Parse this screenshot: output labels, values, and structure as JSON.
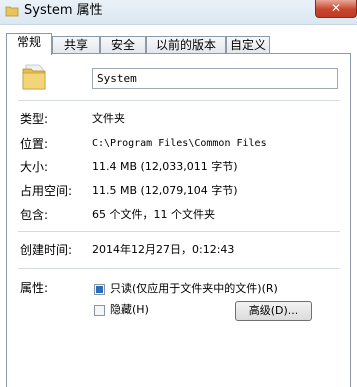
{
  "window": {
    "title": "System 属性",
    "close_label": "✕"
  },
  "tabs": [
    {
      "label": "常规",
      "active": true
    },
    {
      "label": "共享",
      "active": false
    },
    {
      "label": "安全",
      "active": false
    },
    {
      "label": "以前的版本",
      "active": false
    },
    {
      "label": "自定义",
      "active": false
    }
  ],
  "general": {
    "name_value": "System",
    "rows": {
      "type": {
        "label": "类型:",
        "value": "文件夹"
      },
      "location": {
        "label": "位置:",
        "value": "C:\\Program Files\\Common Files"
      },
      "size": {
        "label": "大小:",
        "value": "11.4 MB (12,033,011 字节)"
      },
      "size_on_disk": {
        "label": "占用空间:",
        "value": "11.5 MB (12,079,104 字节)"
      },
      "contains": {
        "label": "包含:",
        "value": "65 个文件，11 个文件夹"
      },
      "created": {
        "label": "创建时间:",
        "value": "2014年12月27日，0:12:43"
      }
    },
    "attributes": {
      "label": "属性:",
      "readonly_label": "只读(仅应用于文件夹中的文件)(R)",
      "readonly_state": "indeterminate",
      "hidden_label": "隐藏(H)",
      "hidden_state": "unchecked",
      "advanced_button": "高级(D)..."
    }
  }
}
